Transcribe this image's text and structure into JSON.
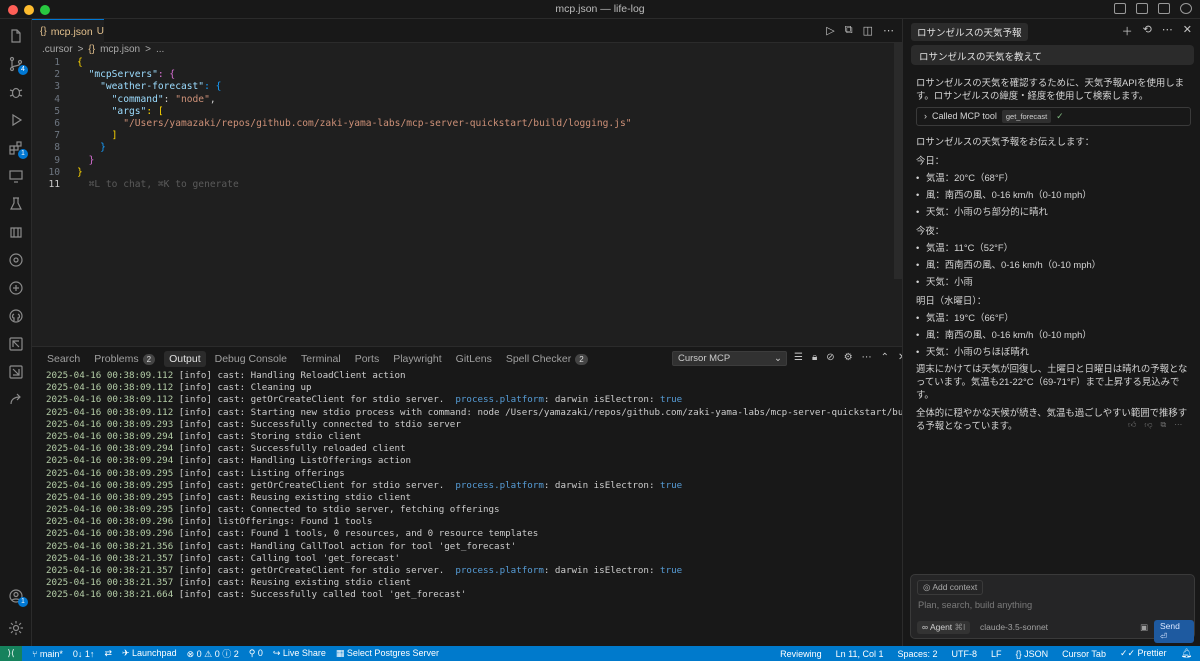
{
  "window": {
    "title": "mcp.json — life-log"
  },
  "editor": {
    "tab": {
      "icon": "{}",
      "name": "mcp.json",
      "modified": "U"
    },
    "breadcrumb": [
      ".cursor",
      ">",
      "{}",
      "mcp.json",
      ">",
      "..."
    ],
    "line_numbers": [
      "1",
      "2",
      "3",
      "4",
      "5",
      "6",
      "7",
      "8",
      "9",
      "10",
      "11"
    ],
    "code": {
      "l1": "{",
      "l2_key": "\"mcpServers\"",
      "l2_rest": ": {",
      "l3_key": "\"weather-forecast\"",
      "l3_rest": ": {",
      "l4_key": "\"command\"",
      "l4_colon": ": ",
      "l4_val": "\"node\"",
      "l4_end": ",",
      "l5_key": "\"args\"",
      "l5_rest": ": [",
      "l6_val": "\"/Users/yamazaki/repos/github.com/zaki-yama-labs/mcp-server-quickstart/build/logging.js\"",
      "l7": "]",
      "l8": "}",
      "l9": "}",
      "l10": "}",
      "l11_hint": "⌘L to chat, ⌘K to generate"
    }
  },
  "panel": {
    "tabs": [
      {
        "label": "Search"
      },
      {
        "label": "Problems",
        "count": "2"
      },
      {
        "label": "Output"
      },
      {
        "label": "Debug Console"
      },
      {
        "label": "Terminal"
      },
      {
        "label": "Ports"
      },
      {
        "label": "Playwright"
      },
      {
        "label": "GitLens"
      },
      {
        "label": "Spell Checker",
        "count": "2"
      }
    ],
    "output_channel": "Cursor MCP",
    "log": [
      {
        "ts": "2025-04-16 00:38:09.112",
        "msg": " [info] cast: Handling ReloadClient action"
      },
      {
        "ts": "2025-04-16 00:38:09.112",
        "msg": " [info] cast: Cleaning up"
      },
      {
        "ts": "2025-04-16 00:38:09.112",
        "msg": " [info] cast: getOrCreateClient for stdio server.  ",
        "hi": "process.platform",
        "msg2": ": darwin isElectron: ",
        "hi2": "true"
      },
      {
        "ts": "2025-04-16 00:38:09.112",
        "msg": " [info] cast: Starting new stdio process with command: node /Users/yamazaki/repos/github.com/zaki-yama-labs/mcp-server-quickstart/build/logging.js"
      },
      {
        "ts": "2025-04-16 00:38:09.293",
        "msg": " [info] cast: Successfully connected to stdio server"
      },
      {
        "ts": "2025-04-16 00:38:09.294",
        "msg": " [info] cast: Storing stdio client"
      },
      {
        "ts": "2025-04-16 00:38:09.294",
        "msg": " [info] cast: Successfully reloaded client"
      },
      {
        "ts": "2025-04-16 00:38:09.294",
        "msg": " [info] cast: Handling ListOfferings action"
      },
      {
        "ts": "2025-04-16 00:38:09.295",
        "msg": " [info] cast: Listing offerings"
      },
      {
        "ts": "2025-04-16 00:38:09.295",
        "msg": " [info] cast: getOrCreateClient for stdio server.  ",
        "hi": "process.platform",
        "msg2": ": darwin isElectron: ",
        "hi2": "true"
      },
      {
        "ts": "2025-04-16 00:38:09.295",
        "msg": " [info] cast: Reusing existing stdio client"
      },
      {
        "ts": "2025-04-16 00:38:09.295",
        "msg": " [info] cast: Connected to stdio server, fetching offerings"
      },
      {
        "ts": "2025-04-16 00:38:09.296",
        "msg": " [info] listOfferings: Found 1 tools"
      },
      {
        "ts": "2025-04-16 00:38:09.296",
        "msg": " [info] cast: Found 1 tools, 0 resources, and 0 resource templates"
      },
      {
        "ts": "2025-04-16 00:38:21.356",
        "msg": " [info] cast: Handling CallTool action for tool 'get_forecast'"
      },
      {
        "ts": "2025-04-16 00:38:21.357",
        "msg": " [info] cast: Calling tool 'get_forecast'"
      },
      {
        "ts": "2025-04-16 00:38:21.357",
        "msg": " [info] cast: getOrCreateClient for stdio server.  ",
        "hi": "process.platform",
        "msg2": ": darwin isElectron: ",
        "hi2": "true"
      },
      {
        "ts": "2025-04-16 00:38:21.357",
        "msg": " [info] cast: Reusing existing stdio client"
      },
      {
        "ts": "2025-04-16 00:38:21.664",
        "msg": " [info] cast: Successfully called tool 'get_forecast'"
      }
    ]
  },
  "chat": {
    "header_title": "ロサンゼルスの天気予報",
    "user_message": "ロサンゼルスの天気を教えて",
    "intro": "ロサンゼルスの天気を確認するために、天気予報APIを使用します。ロサンゼルスの緯度・経度を使用して検索します。",
    "tool_call": {
      "label": "Called MCP tool",
      "tool": "get_forecast",
      "status": "✓"
    },
    "forecast_intro": "ロサンゼルスの天気予報をお伝えします：",
    "today": {
      "heading": "今日：",
      "items": [
        "気温：20°C（68°F）",
        "風：南西の風、0-16 km/h（0-10 mph）",
        "天気：小雨のち部分的に晴れ"
      ]
    },
    "tonight": {
      "heading": "今夜：",
      "items": [
        "気温：11°C（52°F）",
        "風：西南西の風、0-16 km/h（0-10 mph）",
        "天気：小雨"
      ]
    },
    "tomorrow": {
      "heading": "明日（水曜日）：",
      "items": [
        "気温：19°C（66°F）",
        "風：南西の風、0-16 km/h（0-10 mph）",
        "天気：小雨のちほぼ晴れ"
      ]
    },
    "weekend": "週末にかけては天気が回復し、土曜日と日曜日は晴れの予報となっています。気温も21-22°C（69-71°F）まで上昇する見込みです。",
    "summary": "全体的に穏やかな天候が続き、気温も過ごしやすい範囲で推移する予報となっています。",
    "composer": {
      "add_context": "Add context",
      "placeholder": "Plan, search, build anything",
      "mode": "Agent",
      "mode_shortcut": "⌘I",
      "model": "claude-3.5-sonnet",
      "send": "Send"
    }
  },
  "statusbar": {
    "branch": "main*",
    "sync": "0↓ 1↑",
    "launchpad": "Launchpad",
    "problems": "⊗ 0 ⚠ 0 ⓘ 2",
    "ports": "0",
    "liveshare": "Live Share",
    "postgres": "Select Postgres Server",
    "reviewing": "Reviewing",
    "position": "Ln 11, Col 1",
    "spaces": "Spaces: 2",
    "encoding": "UTF-8",
    "eol": "LF",
    "language": "JSON",
    "cursor_tab": "Cursor Tab",
    "prettier": "Prettier"
  }
}
